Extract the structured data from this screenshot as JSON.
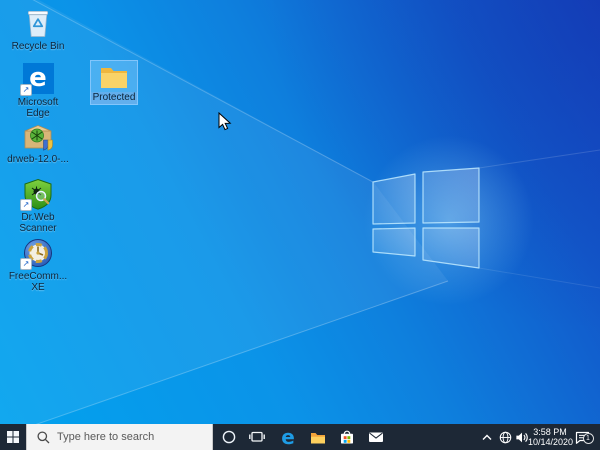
{
  "desktop": {
    "icons": [
      {
        "id": "recycle-bin",
        "lines": [
          "Recycle Bin"
        ]
      },
      {
        "id": "microsoft-edge",
        "lines": [
          "Microsoft",
          "Edge"
        ]
      },
      {
        "id": "drweb-installer",
        "lines": [
          "drweb-12.0-..."
        ]
      },
      {
        "id": "drweb-scanner",
        "lines": [
          "Dr.Web",
          "Scanner"
        ]
      },
      {
        "id": "freecommander",
        "lines": [
          "FreeComm...",
          "XE"
        ]
      },
      {
        "id": "protected-folder",
        "lines": [
          "Protected"
        ],
        "selected": true
      }
    ]
  },
  "taskbar": {
    "search": {
      "placeholder": "Type here to search"
    },
    "buttons": [
      "start",
      "cortana",
      "task-view",
      "edge",
      "file-explorer",
      "store",
      "mail"
    ],
    "tray": {
      "time": "3:58 PM",
      "date": "10/14/2020",
      "notification_badge": "1"
    }
  },
  "glyphs": {
    "edge_e": "e",
    "shortcut_arrow": "↗"
  },
  "colors": {
    "taskbar_bg": "#1d2836",
    "search_bg": "#f3f3f3",
    "selection_highlight": "#99d1ff",
    "edge_tile_blue": "#0078d7",
    "wallpaper_bright": "#00a3ee",
    "wallpaper_dark": "#1647c2",
    "store_red": "#f25022",
    "store_green": "#7fba00",
    "store_blue": "#00a4ef",
    "store_yellow": "#ffb900"
  }
}
